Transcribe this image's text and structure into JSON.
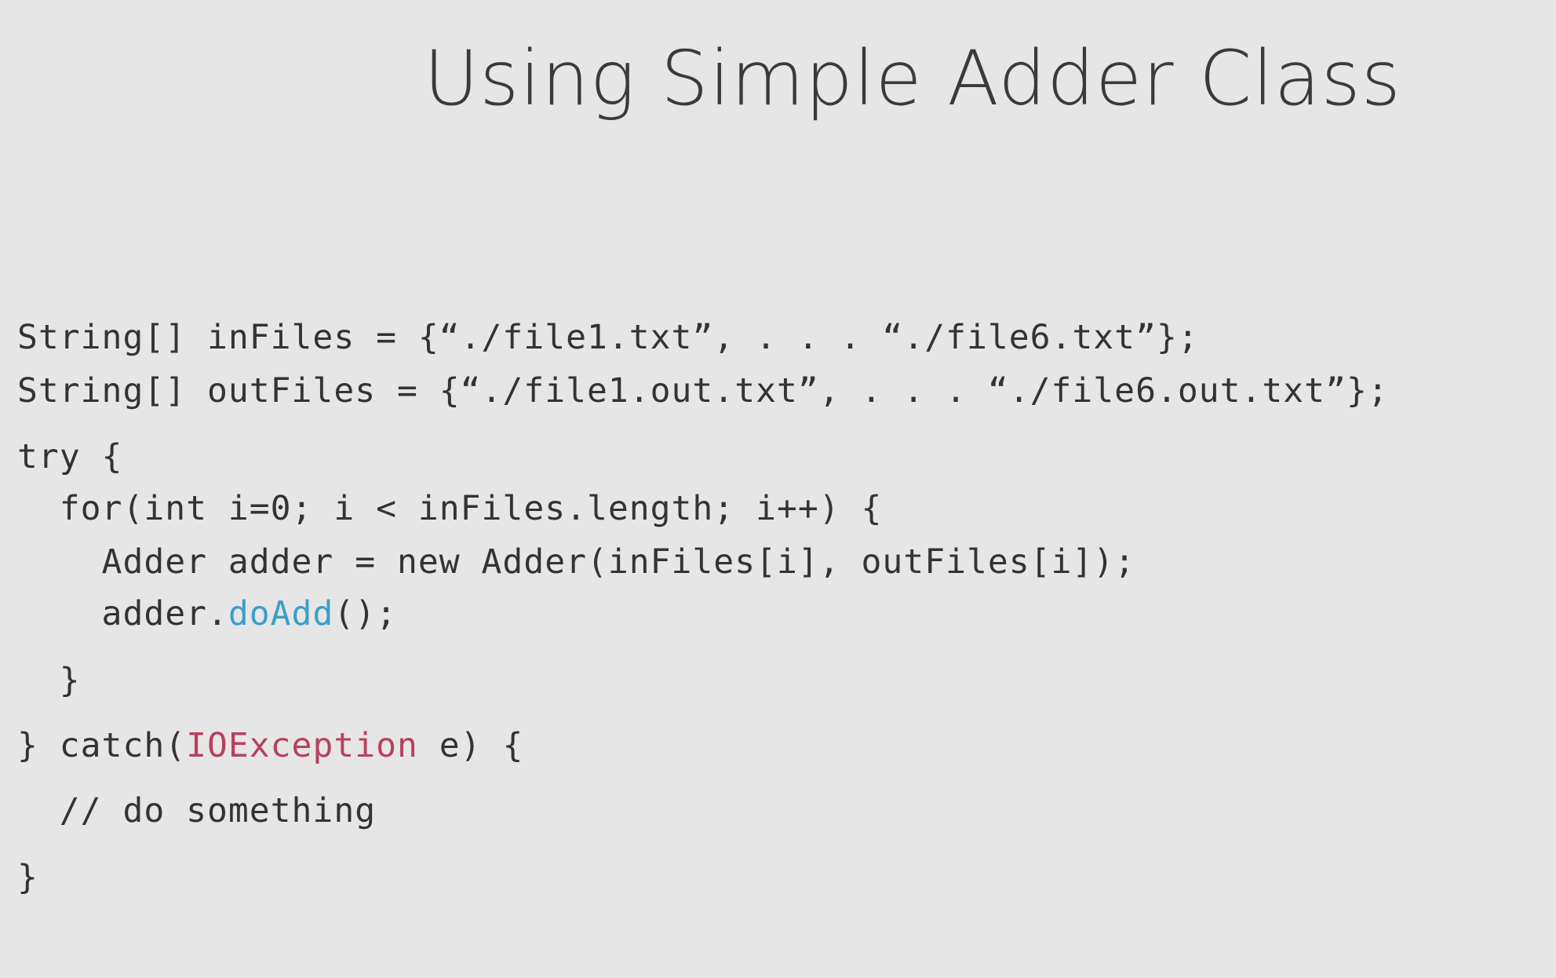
{
  "slide": {
    "title": "Using Simple Adder Class"
  },
  "code": {
    "line1": "String[] inFiles = {“./file1.txt”, . . . “./file6.txt”};",
    "line2": "String[] outFiles = {“./file1.out.txt”, . . . “./file6.out.txt”};",
    "line3": "try {",
    "line4": "  for(int i=0; i < inFiles.length; i++) {",
    "line5": "    Adder adder = new Adder(inFiles[i], outFiles[i]);",
    "line6_prefix": "    adder.",
    "line6_method": "doAdd",
    "line6_suffix": "();",
    "line7": "  }",
    "line8_prefix": "} catch(",
    "line8_type": "IOException",
    "line8_suffix": " e) {",
    "line9": "  // do something",
    "line10": "}"
  },
  "colors": {
    "background": "#e6e6e6",
    "text": "#333333",
    "method_highlight": "#3a9fc6",
    "type_highlight": "#b8405e"
  }
}
